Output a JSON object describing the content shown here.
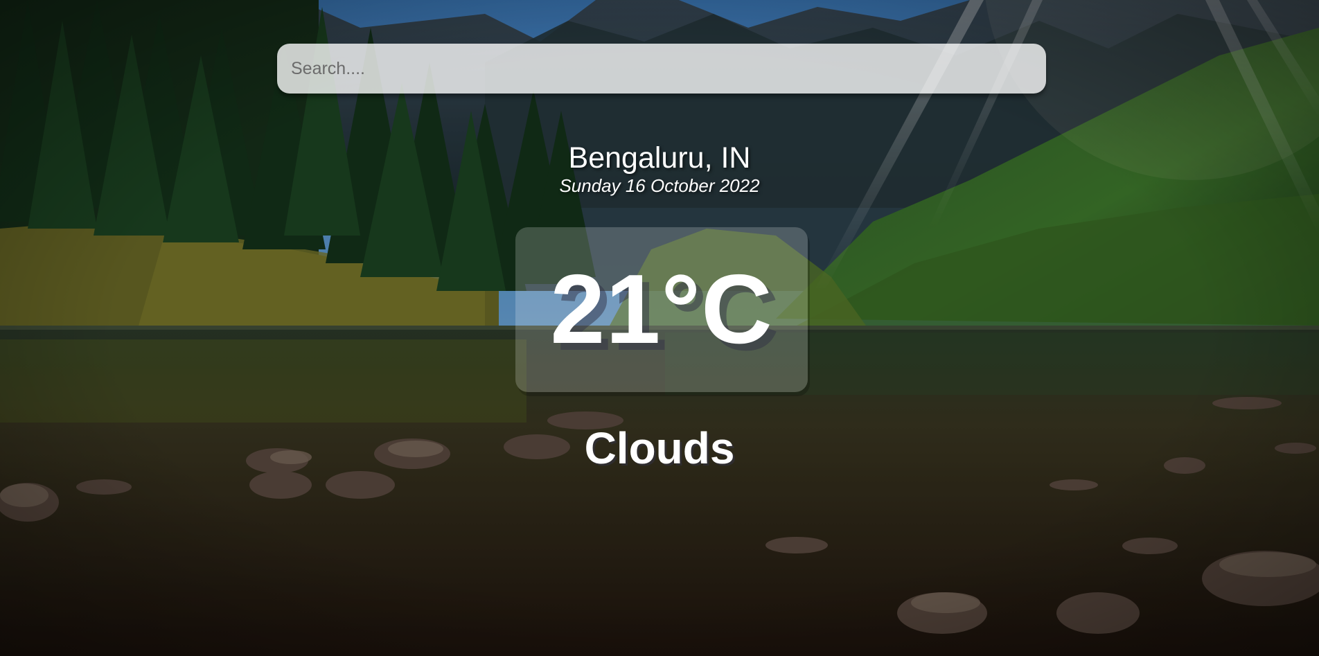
{
  "search": {
    "placeholder": "Search....",
    "value": ""
  },
  "location": {
    "city": "Bengaluru, IN",
    "date": "Sunday 16 October 2022"
  },
  "weather": {
    "temperature": "21°C",
    "condition": "Clouds"
  },
  "colors": {
    "text": "#ffffff",
    "search_bg": "rgba(255,255,255,0.78)",
    "card_bg": "rgba(255,255,255,0.2)"
  }
}
